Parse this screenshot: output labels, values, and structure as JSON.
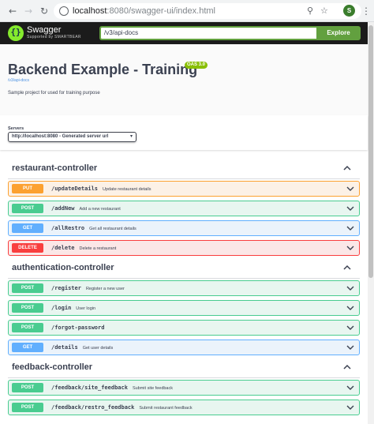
{
  "browser": {
    "url_host": "localhost",
    "url_path": ":8080/swagger-ui/index.html",
    "profile_initial": "S",
    "back_icon": "arrow-left-icon",
    "forward_icon": "arrow-right-icon",
    "reload_icon": "reload-icon"
  },
  "topbar": {
    "logo_text": "Swagger",
    "logo_subtext": "Supported by SMARTBEAR",
    "spec_url": "/v3/api-docs",
    "explore_label": "Explore"
  },
  "info": {
    "title": "Backend Example - Training",
    "version_badge": "OAS 3.0",
    "spec_link": "/v3/api-docs",
    "description": "Sample project for used for training purpose"
  },
  "servers": {
    "label": "Servers",
    "selected": "http://localhost:8080 - Generated server url"
  },
  "colors": {
    "put": "#fca130",
    "post": "#49cc90",
    "get": "#61affe",
    "delete": "#f93e3e",
    "accent": "#62a03f"
  },
  "controllers": [
    {
      "name": "restaurant-controller",
      "operations": [
        {
          "method": "PUT",
          "path": "/updateDetails",
          "summary": "Update restaurant details"
        },
        {
          "method": "POST",
          "path": "/addNew",
          "summary": "Add a new restaurant"
        },
        {
          "method": "GET",
          "path": "/allRestro",
          "summary": "Get all restaurant details"
        },
        {
          "method": "DELETE",
          "path": "/delete",
          "summary": "Delete a restaurant"
        }
      ]
    },
    {
      "name": "authentication-controller",
      "operations": [
        {
          "method": "POST",
          "path": "/register",
          "summary": "Register a new user"
        },
        {
          "method": "POST",
          "path": "/login",
          "summary": "User login"
        },
        {
          "method": "POST",
          "path": "/forgot-password",
          "summary": ""
        },
        {
          "method": "GET",
          "path": "/details",
          "summary": "Get user details"
        }
      ]
    },
    {
      "name": "feedback-controller",
      "operations": [
        {
          "method": "POST",
          "path": "/feedback/site_feedback",
          "summary": "Submit site feedback"
        },
        {
          "method": "POST",
          "path": "/feedback/restro_feedback",
          "summary": "Submit restaurant feedback"
        }
      ]
    }
  ]
}
